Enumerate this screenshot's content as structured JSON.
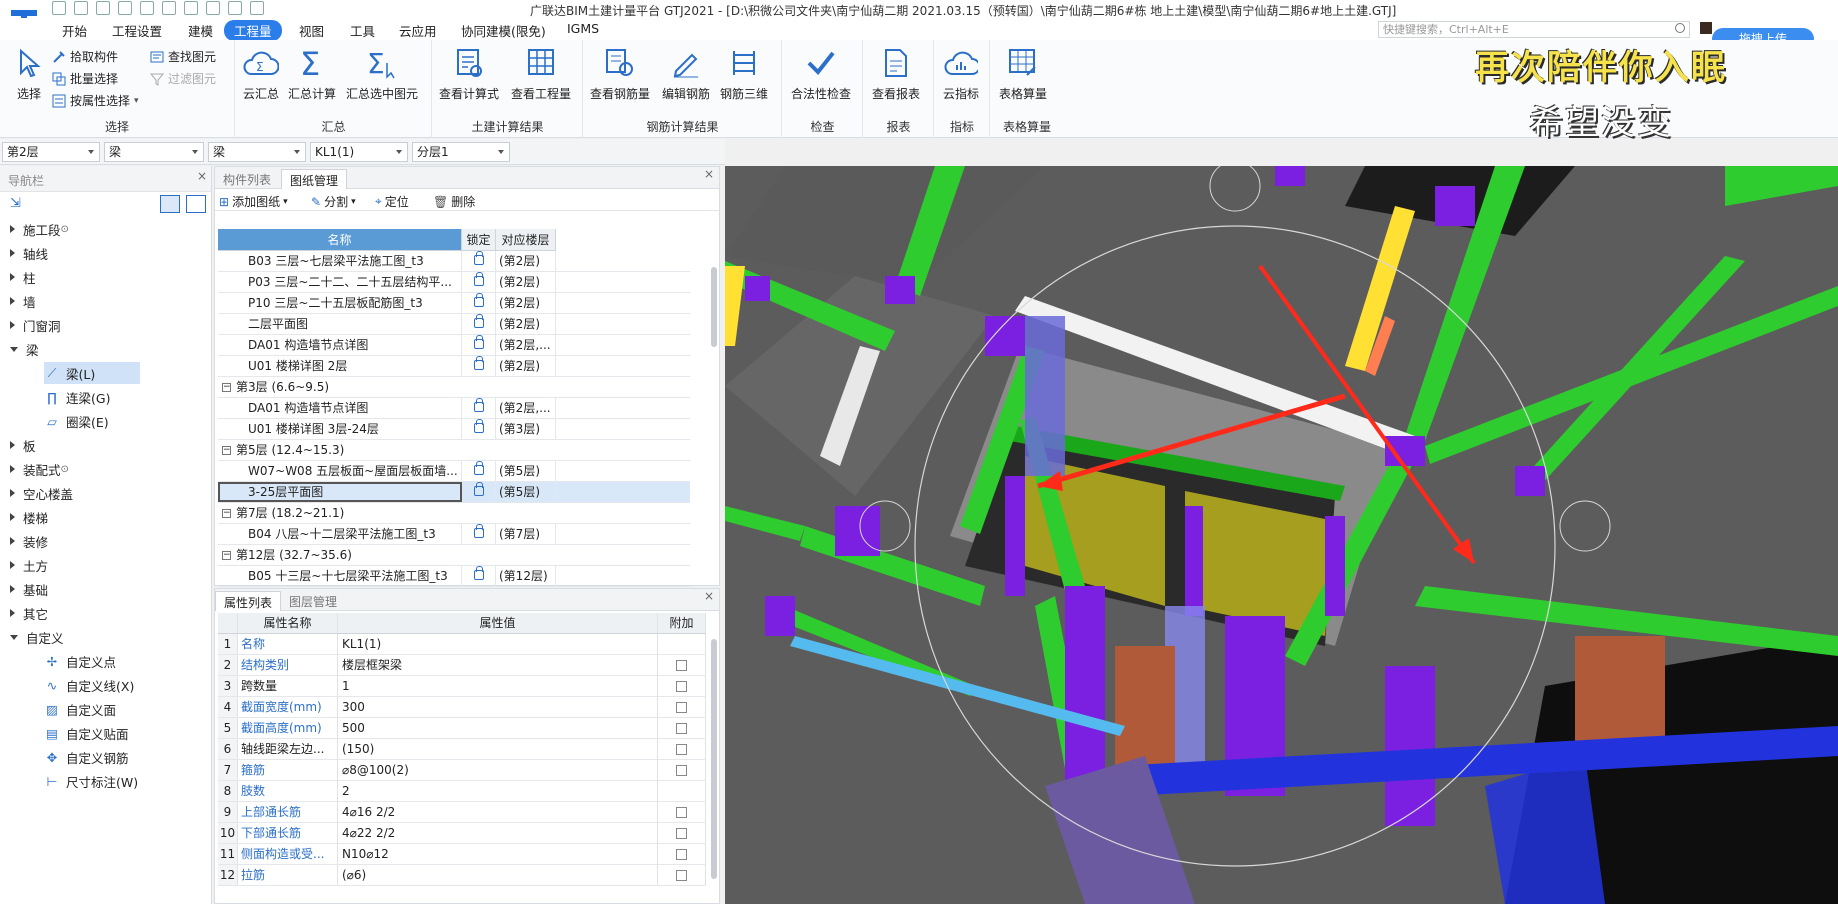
{
  "titlebar": {
    "title": "广联达BIM土建计量平台 GTJ2021 - [D:\\积微公司文件夹\\南宁仙葫二期 2021.03.15（预转国）\\南宁仙葫二期6#栋 地上土建\\模型\\南宁仙葫二期6#地上土建.GTJ]"
  },
  "menu": {
    "items": [
      "开始",
      "工程设置",
      "建模",
      "工程量",
      "视图",
      "工具",
      "云应用",
      "协同建模(限免)",
      "IGMS"
    ],
    "active": "工程量",
    "search_placeholder": "快捷键搜索，Ctrl+Alt+E",
    "upload_label": "拖拽上传"
  },
  "ribbon": {
    "select_group": {
      "label": "选择",
      "select": "选择",
      "pick": "拾取构件",
      "batch": "批量选择",
      "by_attr": "按属性选择",
      "find": "查找图元",
      "filter": "过滤图元"
    },
    "sum_group": {
      "label": "汇总",
      "cloud": "云汇总",
      "calc": "汇总计算",
      "calc_selected": "汇总选中图元"
    },
    "civil_group": {
      "label": "土建计算结果",
      "view_formula": "查看计算式",
      "view_qty": "查看工程量"
    },
    "rebar_group": {
      "label": "钢筋计算结果",
      "view_rebar": "查看钢筋量",
      "edit_rebar": "编辑钢筋",
      "rebar_3d": "钢筋三维"
    },
    "check_group": {
      "label": "检查",
      "validity": "合法性检查"
    },
    "report_group": {
      "label": "报表",
      "view_report": "查看报表"
    },
    "index_group": {
      "label": "指标",
      "cloud_index": "云指标"
    },
    "table_group": {
      "label": "表格算量",
      "table_calc": "表格算量"
    }
  },
  "filters": {
    "floor": "第2层",
    "type1": "梁",
    "type2": "梁",
    "component": "KL1(1)",
    "sublayer": "分层1"
  },
  "nav": {
    "header": "导航栏",
    "items": [
      {
        "label": "施工段",
        "state": "closed",
        "lock": true
      },
      {
        "label": "轴线",
        "state": "closed"
      },
      {
        "label": "柱",
        "state": "closed"
      },
      {
        "label": "墙",
        "state": "closed"
      },
      {
        "label": "门窗洞",
        "state": "closed"
      },
      {
        "label": "梁",
        "state": "open"
      },
      {
        "label": "板",
        "state": "closed"
      },
      {
        "label": "装配式",
        "state": "closed",
        "lock": true
      },
      {
        "label": "空心楼盖",
        "state": "closed"
      },
      {
        "label": "楼梯",
        "state": "closed"
      },
      {
        "label": "装修",
        "state": "closed"
      },
      {
        "label": "土方",
        "state": "closed"
      },
      {
        "label": "基础",
        "state": "closed"
      },
      {
        "label": "其它",
        "state": "closed"
      },
      {
        "label": "自定义",
        "state": "open"
      }
    ],
    "beam_children": [
      "梁(L)",
      "连梁(G)",
      "圈梁(E)"
    ],
    "custom_children": [
      "自定义点",
      "自定义线(X)",
      "自定义面",
      "自定义贴面",
      "自定义钢筋",
      "尺寸标注(W)"
    ]
  },
  "drawing_panel": {
    "tabs": [
      "构件列表",
      "图纸管理"
    ],
    "active_tab": "图纸管理",
    "toolbar": {
      "add": "添加图纸",
      "split": "分割",
      "locate": "定位",
      "delete": "删除"
    },
    "columns": [
      "名称",
      "锁定",
      "对应楼层"
    ],
    "rows": [
      {
        "type": "item",
        "name": "B03 三层~七层梁平法施工图_t3",
        "floor": "(第2层)"
      },
      {
        "type": "item",
        "name": "P03 三层~二十二、二十五层结构平...",
        "floor": "(第2层)"
      },
      {
        "type": "item",
        "name": "P10 三层~二十五层板配筋图_t3",
        "floor": "(第2层)"
      },
      {
        "type": "item",
        "name": "二层平面图",
        "floor": "(第2层)"
      },
      {
        "type": "item",
        "name": "DA01 构造墙节点详图",
        "floor": "(第2层,..."
      },
      {
        "type": "item",
        "name": "U01 楼梯详图 2层",
        "floor": "(第2层)"
      },
      {
        "type": "group",
        "name": "第3层 (6.6~9.5)"
      },
      {
        "type": "item",
        "name": "DA01 构造墙节点详图",
        "floor": "(第2层,..."
      },
      {
        "type": "item",
        "name": "U01 楼梯详图 3层-24层",
        "floor": "(第3层)"
      },
      {
        "type": "group",
        "name": "第5层 (12.4~15.3)"
      },
      {
        "type": "item",
        "name": "W07~W08 五层板面~屋面层板面墙...",
        "floor": "(第5层)"
      },
      {
        "type": "item",
        "name": "3-25层平面图",
        "floor": "(第5层)",
        "selected": true
      },
      {
        "type": "group",
        "name": "第7层 (18.2~21.1)"
      },
      {
        "type": "item",
        "name": "B04 八层~十二层梁平法施工图_t3",
        "floor": "(第7层)"
      },
      {
        "type": "group",
        "name": "第12层 (32.7~35.6)"
      },
      {
        "type": "item",
        "name": "B05 十三层~十七层梁平法施工图_t3",
        "floor": "(第12层)"
      }
    ]
  },
  "property_panel": {
    "tabs": [
      "属性列表",
      "图层管理"
    ],
    "active_tab": "属性列表",
    "columns": [
      "属性名称",
      "属性值",
      "附加"
    ],
    "rows": [
      {
        "num": "1",
        "name": "名称",
        "value": "KL1(1)",
        "blue": true,
        "check": false
      },
      {
        "num": "2",
        "name": "结构类别",
        "value": "楼层框架梁",
        "blue": true,
        "check": true
      },
      {
        "num": "3",
        "name": "跨数量",
        "value": "1",
        "blue": false,
        "check": true
      },
      {
        "num": "4",
        "name": "截面宽度(mm)",
        "value": "300",
        "blue": true,
        "check": true
      },
      {
        "num": "5",
        "name": "截面高度(mm)",
        "value": "500",
        "blue": true,
        "check": true
      },
      {
        "num": "6",
        "name": "轴线距梁左边...",
        "value": "(150)",
        "blue": false,
        "check": true
      },
      {
        "num": "7",
        "name": "箍筋",
        "value": "⌀8@100(2)",
        "blue": true,
        "check": true
      },
      {
        "num": "8",
        "name": "肢数",
        "value": "2",
        "blue": true,
        "check": false
      },
      {
        "num": "9",
        "name": "上部通长筋",
        "value": "4⌀16 2/2",
        "blue": true,
        "check": true
      },
      {
        "num": "10",
        "name": "下部通长筋",
        "value": "4⌀22 2/2",
        "blue": true,
        "check": true
      },
      {
        "num": "11",
        "name": "侧面构造或受...",
        "value": "N10⌀12",
        "blue": true,
        "check": true
      },
      {
        "num": "12",
        "name": "拉筋",
        "value": "(⌀6)",
        "blue": true,
        "check": true
      }
    ]
  },
  "overlay": {
    "line1": "再次陪伴你入眠",
    "line2": "希望没变"
  },
  "colors": {
    "accent": "#2b7de9",
    "beam_green": "#2ecc2e",
    "column_purple": "#7b1fe0",
    "wall_yellow": "#a69e1e",
    "arrow_red": "#ff2a1a"
  }
}
